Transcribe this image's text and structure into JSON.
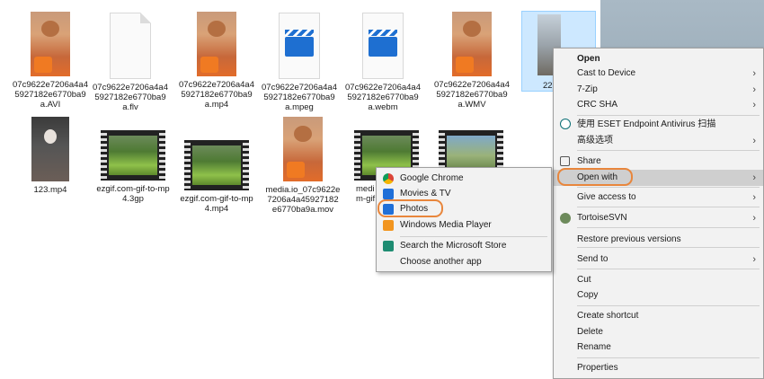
{
  "files": {
    "row1": [
      {
        "name": "07c9622e7206a4a45927182e6770ba9a.AVI",
        "icon": "video-thumbnail"
      },
      {
        "name": "07c9622e7206a4a45927182e6770ba9a.flv",
        "icon": "generic-file-icon"
      },
      {
        "name": "07c9622e7206a4a45927182e6770ba9a.mp4",
        "icon": "video-thumbnail"
      },
      {
        "name": "07c9622e7206a4a45927182e6770ba9a.mpeg",
        "icon": "clapperboard-icon"
      },
      {
        "name": "07c9622e7206a4a45927182e6770ba9a.webm",
        "icon": "clapperboard-icon"
      },
      {
        "name": "07c9622e7206a4a45927182e6770ba9a.WMV",
        "icon": "video-thumbnail"
      }
    ],
    "row2": [
      {
        "name": "123.mp4",
        "icon": "video-thumbnail"
      },
      {
        "name": "ezgif.com-gif-to-mp4.3gp",
        "icon": "filmstrip-thumbnail"
      },
      {
        "name": "ezgif.com-gif-to-mp4.mp4",
        "icon": "filmstrip-thumbnail"
      },
      {
        "name": "media.io_07c9622e7206a4a45927182e6770ba9a.mov",
        "icon": "video-thumbnail"
      },
      {
        "name": "medi",
        "name2": "m-gif",
        "icon": "filmstrip-thumbnail"
      }
    ],
    "selected_label": "22"
  },
  "context_menu": {
    "open": "Open",
    "cast": "Cast to Device",
    "zip": "7-Zip",
    "crc": "CRC SHA",
    "eset": "使用 ESET Endpoint Antivirus 扫描",
    "advanced": "高级选项",
    "share": "Share",
    "open_with": "Open with",
    "give_access": "Give access to",
    "tortoise": "TortoiseSVN",
    "restore": "Restore previous versions",
    "send_to": "Send to",
    "cut": "Cut",
    "copy": "Copy",
    "create_shortcut": "Create shortcut",
    "delete": "Delete",
    "rename": "Rename",
    "properties": "Properties"
  },
  "open_with_menu": {
    "chrome": "Google Chrome",
    "movies": "Movies & TV",
    "photos": "Photos",
    "wmp": "Windows Media Player",
    "store": "Search the Microsoft Store",
    "choose": "Choose another app"
  },
  "highlight_color": "#e8863c"
}
